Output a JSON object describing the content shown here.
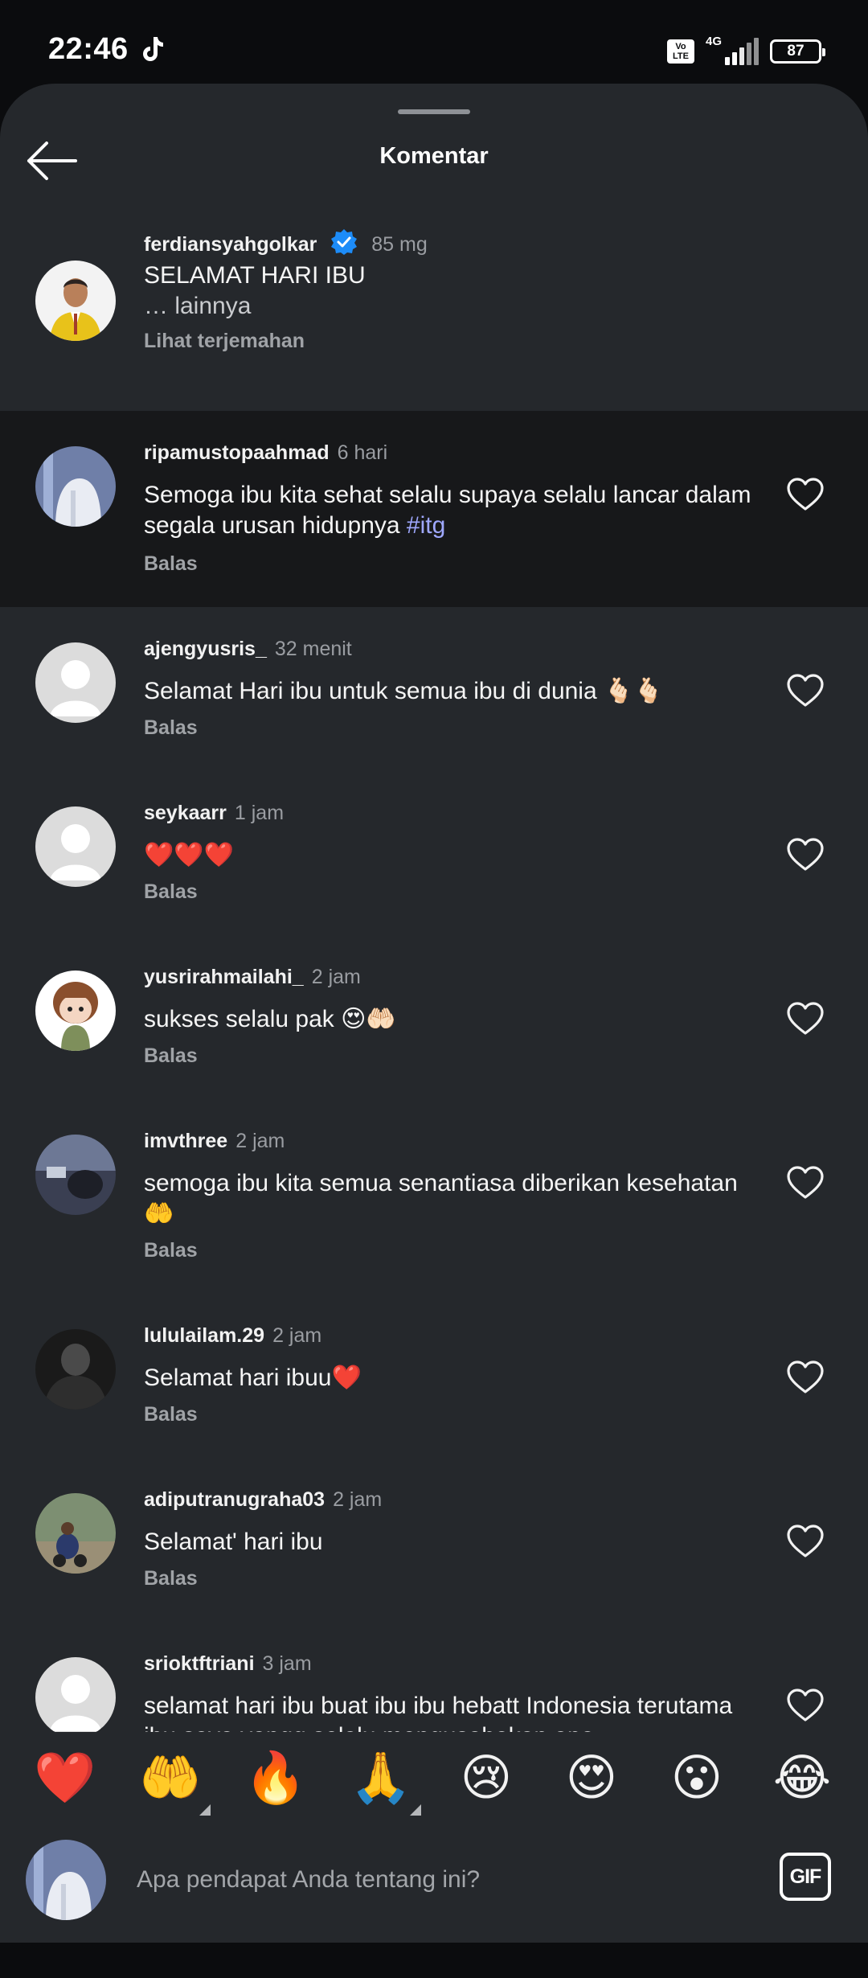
{
  "status_bar": {
    "time": "22:46",
    "volte_top": "Vo",
    "volte_bottom": "LTE",
    "network": "4G",
    "battery": "87"
  },
  "header": {
    "title": "Komentar"
  },
  "caption": {
    "username": "ferdiansyahgolkar",
    "verified": true,
    "time": "85 mg",
    "text": "SELAMAT HARI IBU",
    "more": "… lainnya",
    "translate": "Lihat terjemahan"
  },
  "comments": [
    {
      "username": "ripamustopaahmad",
      "time": "6 hari",
      "text": "Semoga ibu kita sehat selalu  supaya selalu lancar dalam  segala urusan hidupnya ",
      "hashtag": "#itg",
      "reply": "Balas"
    },
    {
      "username": "ajengyusris_",
      "time": "32 menit",
      "text": "Selamat Hari ibu untuk semua ibu di dunia 🫰🏻🫰🏻",
      "reply": "Balas"
    },
    {
      "username": "seykaarr",
      "time": "1 jam",
      "text": "❤️❤️❤️",
      "reply": "Balas"
    },
    {
      "username": "yusrirahmailahi_",
      "time": "2 jam",
      "text": "sukses selalu pak 😍🤲🏻",
      "reply": "Balas"
    },
    {
      "username": "imvthree",
      "time": "2 jam",
      "text": "semoga ibu kita semua senantiasa diberikan kesehatan🤲",
      "reply": "Balas"
    },
    {
      "username": "lululailam.29",
      "time": "2 jam",
      "text": "Selamat hari ibuu❤️",
      "reply": "Balas"
    },
    {
      "username": "adiputranugraha03",
      "time": "2 jam",
      "text": "Selamat' hari ibu",
      "reply": "Balas"
    },
    {
      "username": "srioktftriani",
      "time": "3 jam",
      "text": "selamat hari ibu buat ibu ibu hebatt Indonesia terutama ibu saya yangg selalu mengusahakan apa",
      "reply": "Balas"
    }
  ],
  "quick_reactions": [
    "❤️",
    "🤲",
    "🔥",
    "🙏",
    "😢",
    "😍",
    "😮",
    "😂"
  ],
  "composer": {
    "placeholder": "Apa pendapat Anda tentang ini?",
    "gif_label": "GIF"
  },
  "colors": {
    "sheet_background": "#25282c",
    "highlight_row": "#17181a",
    "hashtag": "#9fa8ff",
    "verified_badge": "#1d8cf8",
    "muted_text": "#9a9da2"
  },
  "icons": [
    "back-arrow-icon",
    "verified-badge-icon",
    "heart-outline-icon",
    "tiktok-icon",
    "gif-icon"
  ]
}
